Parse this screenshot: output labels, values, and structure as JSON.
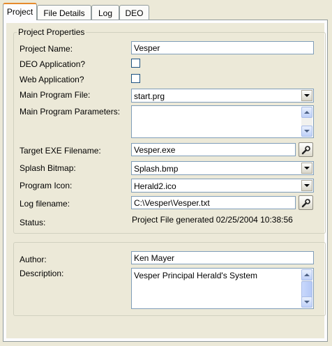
{
  "tabs": [
    {
      "label": "Project",
      "active": true
    },
    {
      "label": "File Details",
      "active": false
    },
    {
      "label": "Log",
      "active": false
    },
    {
      "label": "DEO",
      "active": false
    }
  ],
  "project_properties": {
    "legend": "Project Properties",
    "project_name": {
      "label": "Project Name:",
      "value": "Vesper"
    },
    "deo_application": {
      "label": "DEO Application?",
      "checked": false
    },
    "web_application": {
      "label": "Web Application?",
      "checked": false
    },
    "main_program_file": {
      "label": "Main Program File:",
      "value": "start.prg"
    },
    "main_program_parameters": {
      "label": "Main Program Parameters:",
      "value": ""
    },
    "target_exe": {
      "label": "Target EXE Filename:",
      "value": "Vesper.exe",
      "icon": "wrench-icon"
    },
    "splash_bitmap": {
      "label": "Splash Bitmap:",
      "value": "Splash.bmp"
    },
    "program_icon": {
      "label": "Program Icon:",
      "value": "Herald2.ico"
    },
    "log_filename": {
      "label": "Log filename:",
      "value": "C:\\Vesper\\Vesper.txt",
      "icon": "wrench-icon"
    },
    "status": {
      "label": "Status:",
      "value": "Project File generated 02/25/2004 10:38:56"
    }
  },
  "author_group": {
    "author": {
      "label": "Author:",
      "value": "Ken Mayer"
    },
    "description": {
      "label": "Description:",
      "value": "Vesper Principal Herald's System"
    }
  }
}
